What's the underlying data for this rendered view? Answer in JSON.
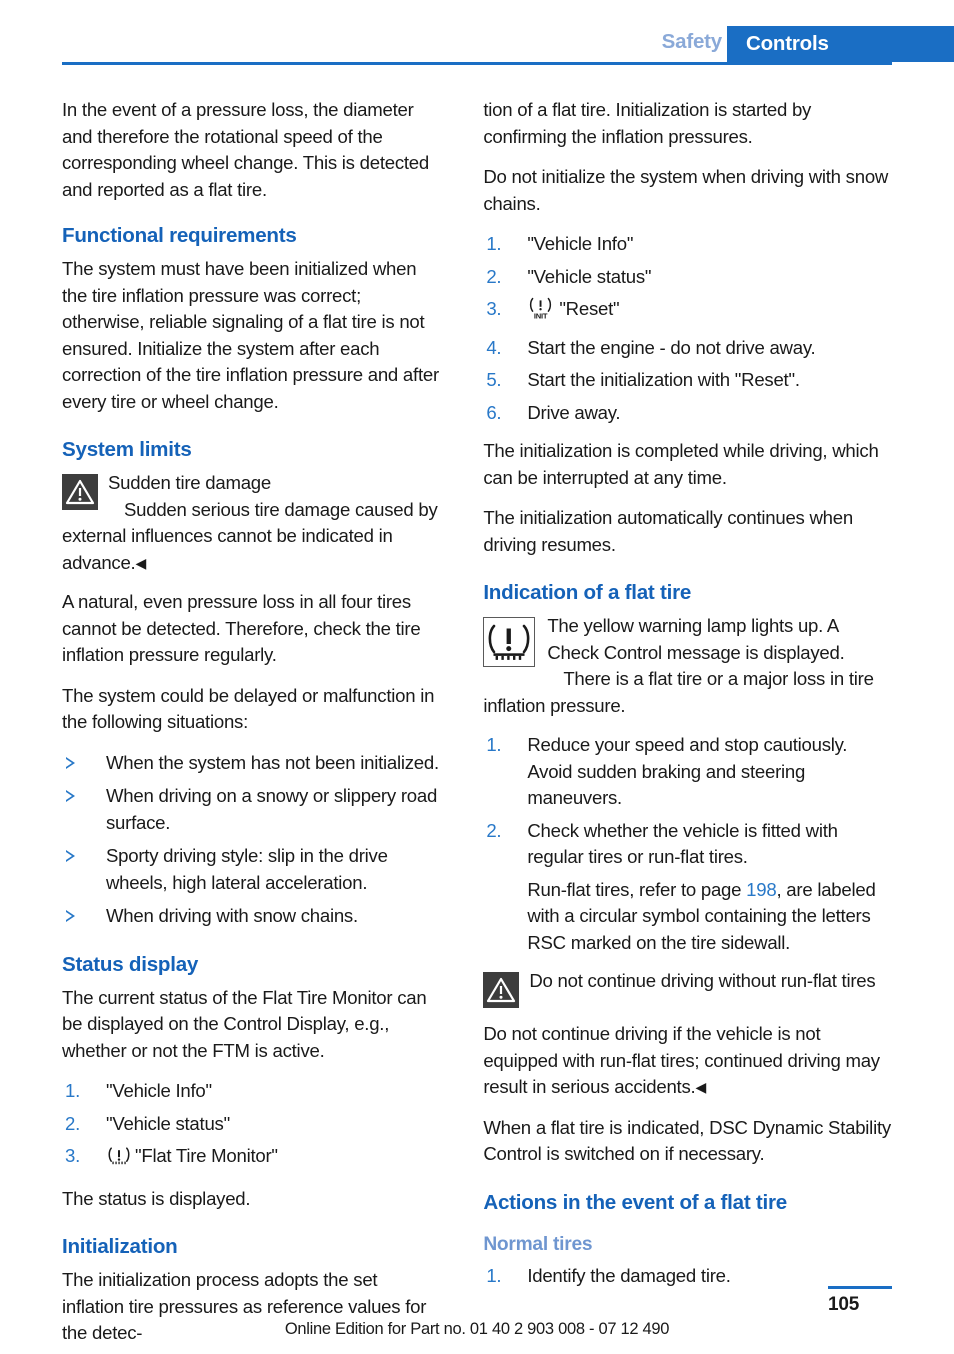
{
  "header": {
    "previous_chapter": "Safety",
    "current_chapter": "Controls"
  },
  "left_column": {
    "intro_paragraph": "In the event of a pressure loss, the diameter and therefore the rotational speed of the corresponding wheel change. This is detected and reported as a flat tire.",
    "functional_requirements": {
      "heading": "Functional requirements",
      "paragraph": "The system must have been initialized when the tire inflation pressure was correct; otherwise, reliable signaling of a flat tire is not ensured. Initialize the system after each correction of the tire inflation pressure and after every tire or wheel change."
    },
    "system_limits": {
      "heading": "System limits",
      "warning": {
        "icon": "warning-triangle-icon",
        "title": "Sudden tire damage",
        "text": "Sudden serious tire damage caused by external influences cannot be indicated in advance.",
        "end_mark": "◀"
      },
      "paragraph_1": "A natural, even pressure loss in all four tires cannot be detected. Therefore, check the tire inflation pressure regularly.",
      "paragraph_2": "The system could be delayed or malfunction in the following situations:",
      "bullets": [
        "When the system has not been initialized.",
        "When driving on a snowy or slippery road surface.",
        "Sporty driving style: slip in the drive wheels, high lateral acceleration.",
        "When driving with snow chains."
      ]
    },
    "status_display": {
      "heading": "Status display",
      "paragraph": "The current status of the Flat Tire Monitor can be displayed on the Control Display, e.g., whether or not the FTM is active.",
      "steps": [
        {
          "num": "1.",
          "text": "\"Vehicle Info\"",
          "icon": null
        },
        {
          "num": "2.",
          "text": "\"Vehicle status\"",
          "icon": null
        },
        {
          "num": "3.",
          "text": "\"Flat Tire Monitor\"",
          "icon": "tire-pressure-icon"
        }
      ],
      "closing": "The status is displayed."
    },
    "initialization": {
      "heading": "Initialization",
      "paragraph": "The initialization process adopts the set inflation tire pressures as reference values for the detec-"
    }
  },
  "right_column": {
    "continued_paragraph": "tion of a flat tire. Initialization is started by confirming the inflation pressures.",
    "paragraph_snow_chains": "Do not initialize the system when driving with snow chains.",
    "init_steps": [
      {
        "num": "1.",
        "text": "\"Vehicle Info\"",
        "icon": null
      },
      {
        "num": "2.",
        "text": "\"Vehicle status\"",
        "icon": null
      },
      {
        "num": "3.",
        "text": "\"Reset\"",
        "icon": "tire-pressure-init-icon"
      },
      {
        "num": "4.",
        "text": "Start the engine - do not drive away.",
        "icon": null
      },
      {
        "num": "5.",
        "text": "Start the initialization with \"Reset\".",
        "icon": null
      },
      {
        "num": "6.",
        "text": "Drive away.",
        "icon": null
      }
    ],
    "paragraph_completed": "The initialization is completed while driving, which can be interrupted at any time.",
    "paragraph_resumes": "The initialization automatically continues when driving resumes.",
    "indication": {
      "heading": "Indication of a flat tire",
      "icon": "tire-pressure-warning-lamp-icon",
      "text_1": "The yellow warning lamp lights up. A Check Control message is displayed.",
      "text_2": "There is a flat tire or a major loss in tire inflation pressure.",
      "steps": [
        {
          "num": "1.",
          "text": "Reduce your speed and stop cautiously. Avoid sudden braking and steering maneuvers.",
          "sub": null
        },
        {
          "num": "2.",
          "text": "Check whether the vehicle is fitted with regular tires or run-flat tires.",
          "sub_prefix": "Run-flat tires, refer to page ",
          "sub_pageref": "198",
          "sub_suffix": ", are labeled with a circular symbol containing the letters RSC marked on the tire sidewall."
        }
      ],
      "warning": {
        "icon": "warning-triangle-icon",
        "title": "Do not continue driving without run-flat tires",
        "text": "Do not continue driving if the vehicle is not equipped with run-flat tires; continued driving may result in serious accidents.",
        "end_mark": "◀"
      },
      "paragraph_dsc": "When a flat tire is indicated, DSC Dynamic Stability Control is switched on if necessary."
    },
    "actions": {
      "heading": "Actions in the event of a flat tire",
      "subheading": "Normal tires",
      "steps": [
        {
          "num": "1.",
          "text": "Identify the damaged tire."
        }
      ]
    }
  },
  "footer": {
    "note": "Online Edition for Part no. 01 40 2 903 008 - 07 12 490",
    "page_number": "105"
  },
  "colors": {
    "accent_blue": "#1a6ec4",
    "heading_blue": "#1562b8",
    "subheading_blue": "#6f96d0",
    "previous_chapter_blue": "#8aa9d8",
    "warning_icon_bg": "#3d3d3d"
  }
}
